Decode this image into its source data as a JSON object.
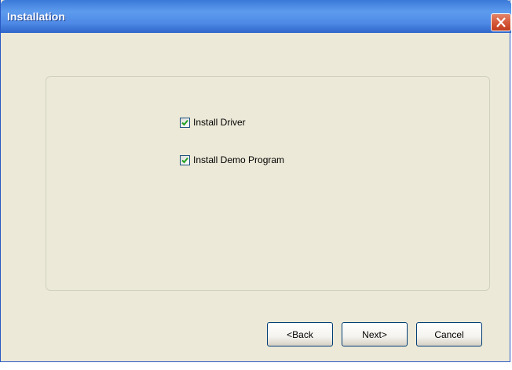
{
  "window": {
    "title": "Installation",
    "close_icon": "close-icon"
  },
  "options": [
    {
      "label": "Install Driver",
      "checked": true
    },
    {
      "label": "Install Demo Program",
      "checked": true
    }
  ],
  "buttons": {
    "back": "<Back",
    "next": "Next>",
    "cancel": "Cancel"
  },
  "colors": {
    "titlebar": "#3a79d8",
    "close": "#d65a3b",
    "dialog_bg": "#ece9d8",
    "checkmark": "#21a121"
  }
}
